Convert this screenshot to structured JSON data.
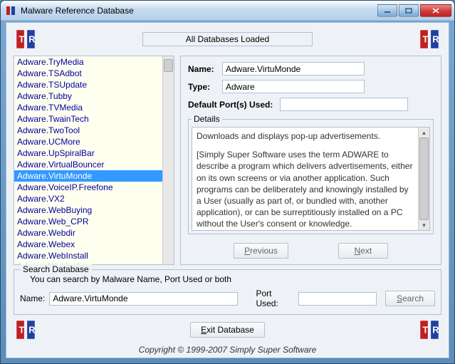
{
  "window": {
    "title": "Malware Reference Database"
  },
  "banner": {
    "status": "All Databases Loaded"
  },
  "list": {
    "items": [
      "Adware.TryMedia",
      "Adware.TSAdbot",
      "Adware.TSUpdate",
      "Adware.Tubby",
      "Adware.TVMedia",
      "Adware.TwainTech",
      "Adware.TwoTool",
      "Adware.UCMore",
      "Adware.UpSpiralBar",
      "Adware.VirtualBouncer",
      "Adware.VirtuMonde",
      "Adware.VoiceIP.Freefone",
      "Adware.VX2",
      "Adware.WebBuying",
      "Adware.Web_CPR",
      "Adware.Webdir",
      "Adware.Webex",
      "Adware.WebInstall",
      "Adware.Weblookup"
    ],
    "selected_index": 10
  },
  "detail": {
    "name_label": "Name:",
    "name_value": "Adware.VirtuMonde",
    "type_label": "Type:",
    "type_value": "Adware",
    "ports_label": "Default Port(s) Used:",
    "ports_value": "",
    "details_legend": "Details",
    "details_p1": "Downloads and displays pop-up advertisements.",
    "details_p2": "[Simply Super Software uses the term ADWARE to describe a program which delivers advertisements, either on its own screens or via another application. Such programs can be deliberately and knowingly installed by a User (usually as part of, or bundled with, another application), or can be surreptitiously installed on a PC without the User's consent or knowledge.",
    "prev_prefix": "P",
    "prev_rest": "revious",
    "next_prefix": "N",
    "next_rest": "ext"
  },
  "search": {
    "legend": "Search Database",
    "hint": "You can search by Malware Name, Port Used or both",
    "name_label": "Name:",
    "name_value": "Adware.VirtuMonde",
    "port_label": "Port Used:",
    "port_value": "",
    "button_prefix": "S",
    "button_rest": "earch"
  },
  "footer": {
    "exit_prefix": "E",
    "exit_rest": "xit Database",
    "copyright": "Copyright © 1999-2007 Simply Super Software"
  }
}
